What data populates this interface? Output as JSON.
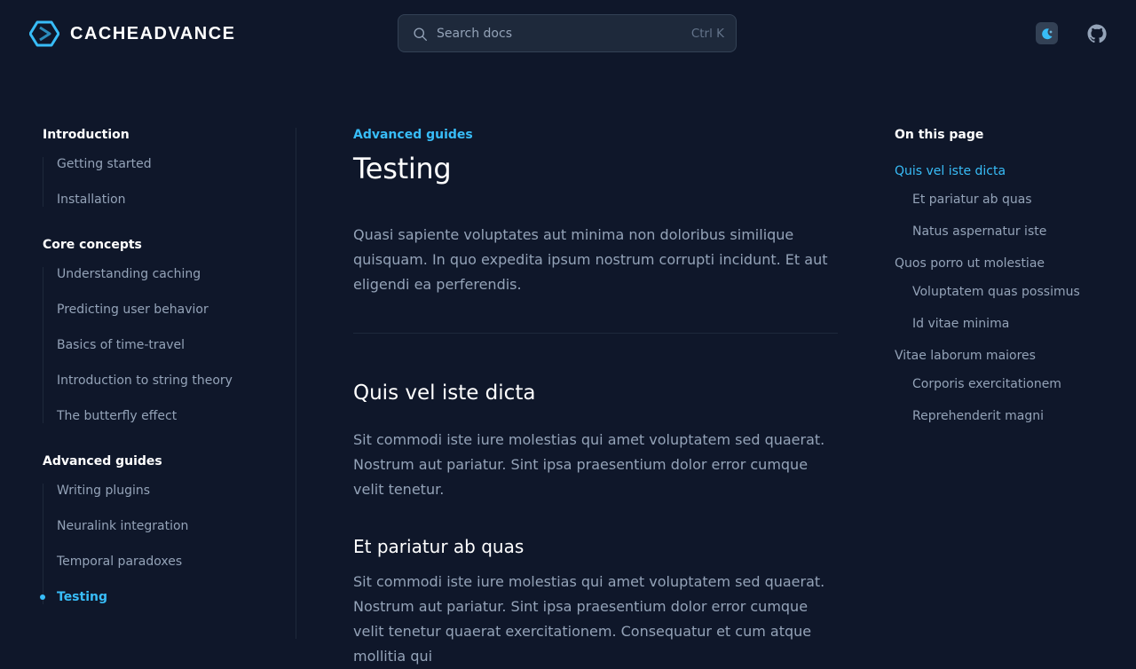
{
  "brand": {
    "name": "CACHEADVANCE",
    "accent": "#38bdf8"
  },
  "search": {
    "placeholder": "Search docs",
    "shortcut": "Ctrl K"
  },
  "nav": {
    "groups": [
      {
        "title": "Introduction",
        "items": [
          "Getting started",
          "Installation"
        ]
      },
      {
        "title": "Core concepts",
        "items": [
          "Understanding caching",
          "Predicting user behavior",
          "Basics of time-travel",
          "Introduction to string theory",
          "The butterfly effect"
        ]
      },
      {
        "title": "Advanced guides",
        "items": [
          "Writing plugins",
          "Neuralink integration",
          "Temporal paradoxes",
          "Testing"
        ]
      }
    ],
    "active_item": "Testing"
  },
  "main": {
    "eyebrow": "Advanced guides",
    "title": "Testing",
    "lead": "Quasi sapiente voluptates aut minima non doloribus similique quisquam. In quo expedita ipsum nostrum corrupti incidunt. Et aut eligendi ea perferendis.",
    "section1_title": "Quis vel iste dicta",
    "section1_body": "Sit commodi iste iure molestias qui amet voluptatem sed quaerat. Nostrum aut pariatur. Sint ipsa praesentium dolor error cumque velit tenetur.",
    "sub1_title": "Et pariatur ab quas",
    "sub1_body": "Sit commodi iste iure molestias qui amet voluptatem sed quaerat. Nostrum aut pariatur. Sint ipsa praesentium dolor error cumque velit tenetur quaerat exercitationem. Consequatur et cum atque mollitia qui"
  },
  "toc": {
    "title": "On this page",
    "items": [
      {
        "label": "Quis vel iste dicta",
        "level": 2,
        "active": true
      },
      {
        "label": "Et pariatur ab quas",
        "level": 3
      },
      {
        "label": "Natus aspernatur iste",
        "level": 3
      },
      {
        "label": "Quos porro ut molestiae",
        "level": 2
      },
      {
        "label": "Voluptatem quas possimus",
        "level": 3
      },
      {
        "label": "Id vitae minima",
        "level": 3
      },
      {
        "label": "Vitae laborum maiores",
        "level": 2
      },
      {
        "label": "Corporis exercitationem",
        "level": 3
      },
      {
        "label": "Reprehenderit magni",
        "level": 3
      }
    ]
  }
}
